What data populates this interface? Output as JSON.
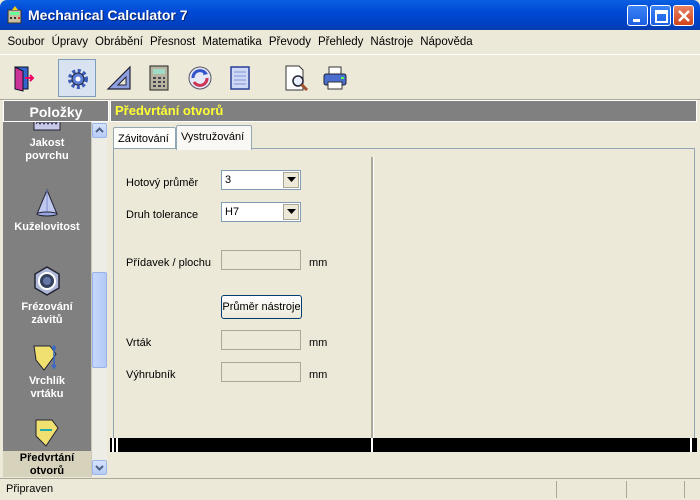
{
  "window": {
    "title": "Mechanical Calculator 7",
    "icon": "calculator-app-icon",
    "controls": [
      "minimize-icon",
      "maximize-icon",
      "close-icon"
    ]
  },
  "menu": [
    "Soubor",
    "Úpravy",
    "Obrábění",
    "Přesnost",
    "Matematika",
    "Převody",
    "Přehledy",
    "Nástroje",
    "Nápověda"
  ],
  "toolbar": {
    "buttons": [
      "exit-door-icon",
      "gear-settings-icon",
      "set-square-icon",
      "calculator-icon",
      "refresh-icon",
      "notebook-icon",
      "print-preview-icon",
      "printer-icon"
    ],
    "pressed": "gear-settings-icon"
  },
  "left_panel": {
    "header": "Položky",
    "items": [
      {
        "label1": "Jakost",
        "label2": "povrchu",
        "icon": "surface-roughness-icon"
      },
      {
        "label1": "Kuželovitost",
        "label2": "",
        "icon": "cone-icon"
      },
      {
        "label1": "Frézování",
        "label2": "závitů",
        "icon": "thread-milling-nut-icon"
      },
      {
        "label1": "Vrchlík",
        "label2": "vrtáku",
        "icon": "drill-tip-icon"
      },
      {
        "label1": "Předvrtání",
        "label2": "otvorů",
        "icon": "pre-drilling-icon",
        "selected": true
      }
    ]
  },
  "right_panel": {
    "header": "Předvrtání otvorů",
    "tabs": [
      "Závitování",
      "Vystružování"
    ],
    "active_tab": "Vystružování",
    "form": {
      "finished_diameter_label": "Hotový průměr",
      "finished_diameter_value": "3",
      "tolerance_label": "Druh tolerance",
      "tolerance_value": "H7",
      "allowance_label": "Přídavek / plochu",
      "allowance_unit": "mm",
      "tool_button": "Průměr nástroje",
      "drill_label": "Vrták",
      "drill_unit": "mm",
      "reamer_label": "Výhrubník",
      "reamer_unit": "mm"
    }
  },
  "status": {
    "text": "Připraven"
  },
  "colors": {
    "title_bar": "#0049d6",
    "panel_header_bg": "#808080",
    "right_header_text": "#ffff33",
    "window_bg": "#ece9d8"
  }
}
